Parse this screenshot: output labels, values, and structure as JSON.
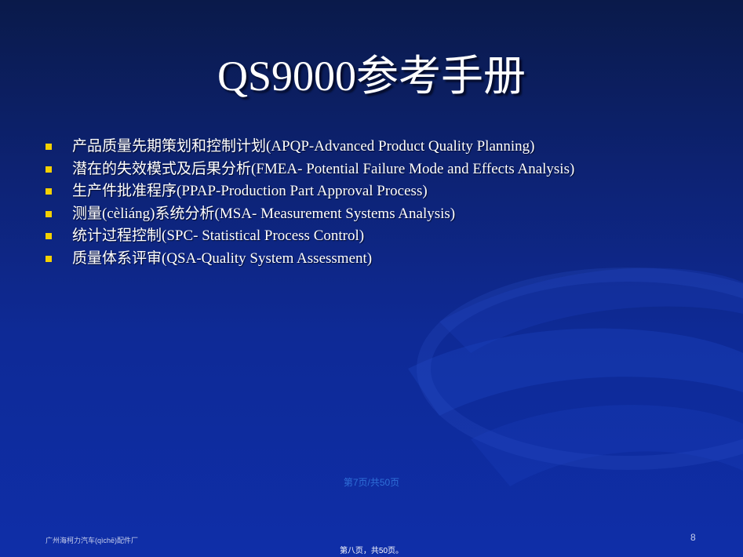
{
  "slide": {
    "title": "QS9000参考手册",
    "bullets": [
      "产品质量先期策划和控制计划(APQP-Advanced Product Quality Planning)",
      "潜在的失效模式及后果分析(FMEA- Potential Failure Mode and Effects Analysis)",
      "生产件批准程序(PPAP-Production Part Approval Process)",
      "测量(cèliáng)系统分析(MSA- Measurement Systems Analysis)",
      "统计过程控制(SPC- Statistical Process Control)",
      "质量体系评审(QSA-Quality System Assessment)"
    ],
    "page_counter": "第7页/共50页",
    "footer_left": "广州海柯力汽车(qìchē)配件厂",
    "slide_number": "8",
    "footer_center": "第八页，共50页。"
  },
  "colors": {
    "background_top": "#0a1a4a",
    "background_bottom": "#0f2ea8",
    "bullet_marker": "#f4d000",
    "text": "#ffffff",
    "page_counter": "#2f6fd8"
  }
}
